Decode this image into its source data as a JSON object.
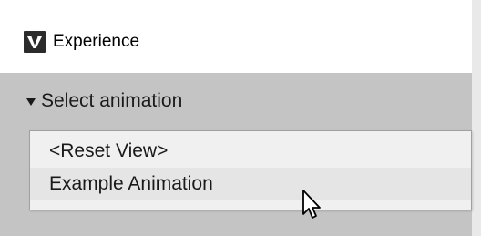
{
  "window": {
    "title": "Experience",
    "logo_icon": "app-logo-icon"
  },
  "section": {
    "label": "Select animation",
    "toggle_icon": "triangle-down-icon"
  },
  "dropdown": {
    "items": [
      {
        "label": "<Reset View>"
      },
      {
        "label": "Example Animation",
        "hovered": true
      }
    ]
  },
  "cursor": {
    "icon": "mouse-pointer-icon"
  },
  "colors": {
    "background": "#c4c4c4",
    "titlebar": "#ffffff",
    "dropdown_bg": "#f0f0f0",
    "hover_bg": "#e5e5e5"
  }
}
